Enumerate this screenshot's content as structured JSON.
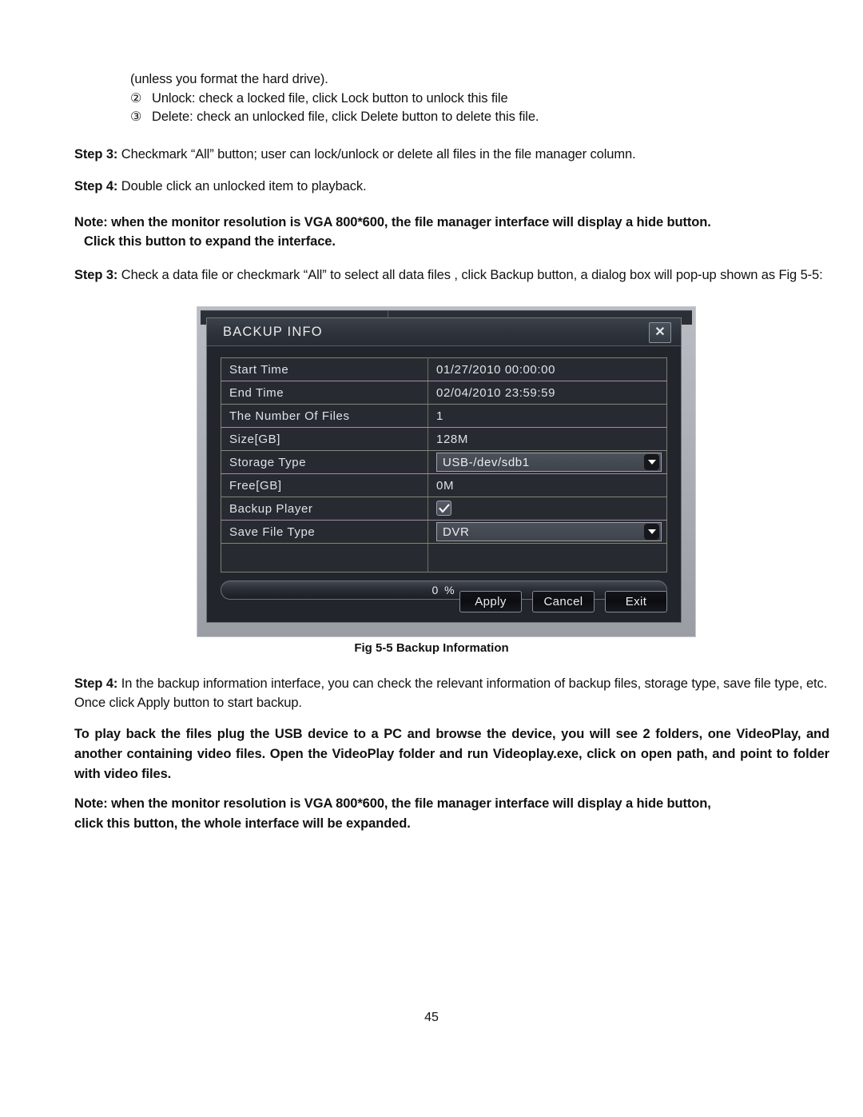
{
  "document": {
    "intro_line": "(unless you format the hard drive).",
    "bullets": [
      {
        "num": "②",
        "text": "Unlock: check a locked file, click Lock button to unlock this file"
      },
      {
        "num": "③",
        "text": "Delete: check an unlocked file, click Delete button to delete this file."
      }
    ],
    "step3a_label": "Step 3:",
    "step3a_text": " Checkmark “All” button; user can lock/unlock or delete all files in the file manager column.",
    "step4a_label": "Step 4:",
    "step4a_text": " Double click an unlocked item to playback.",
    "note1_line1": "Note: when the monitor resolution is VGA 800*600, the file manager interface will display a hide button.",
    "note1_line2": "Click this button to expand the interface.",
    "step3b_label": "Step 3:",
    "step3b_text": " Check a data file or checkmark “All” to select all data files , click Backup button, a dialog box will pop-up shown as Fig 5-5:",
    "step4b_label": "Step 4:",
    "step4b_text": " In the backup information interface, you can check the relevant information of backup files, storage type, save file type, etc. Once click Apply button to start backup.",
    "playback_note": "To play back the files plug the USB device to a PC and browse the device, you will see 2 folders, one VideoPlay, and another containing video files. Open the VideoPlay folder and run Videoplay.exe, click on open path, and point to folder with video files.",
    "note2_line1": "Note: when the monitor resolution is VGA 800*600, the file manager interface will display a hide button,",
    "note2_line2": "click this button, the whole interface will be expanded.",
    "figure_caption": "Fig 5-5 Backup Information",
    "page_number": "45"
  },
  "dialog": {
    "title": "BACKUP INFO",
    "close_icon": "✕",
    "rows": [
      {
        "label": "Start Time",
        "value": "01/27/2010 00:00:00",
        "type": "text"
      },
      {
        "label": "End Time",
        "value": "02/04/2010 23:59:59",
        "type": "text"
      },
      {
        "label": "The Number Of Files",
        "value": "1",
        "type": "text"
      },
      {
        "label": "Size[GB]",
        "value": "128M",
        "type": "text"
      },
      {
        "label": "Storage Type",
        "value": "USB-/dev/sdb1",
        "type": "combo"
      },
      {
        "label": "Free[GB]",
        "value": "0M",
        "type": "text"
      },
      {
        "label": "Backup Player",
        "value": "checked",
        "type": "checkbox"
      },
      {
        "label": "Save File Type",
        "value": "DVR",
        "type": "combo"
      },
      {
        "label": "",
        "value": "",
        "type": "blank"
      }
    ],
    "progress_text": "0 %",
    "buttons": [
      {
        "label": "Apply"
      },
      {
        "label": "Cancel"
      },
      {
        "label": "Exit"
      }
    ],
    "colors": {
      "dialog_bg": "#22262c",
      "titlebar": "#30353d",
      "text": "#dfe2e7",
      "border_pink": "#a48ba8",
      "border_olive": "#83866e"
    }
  }
}
